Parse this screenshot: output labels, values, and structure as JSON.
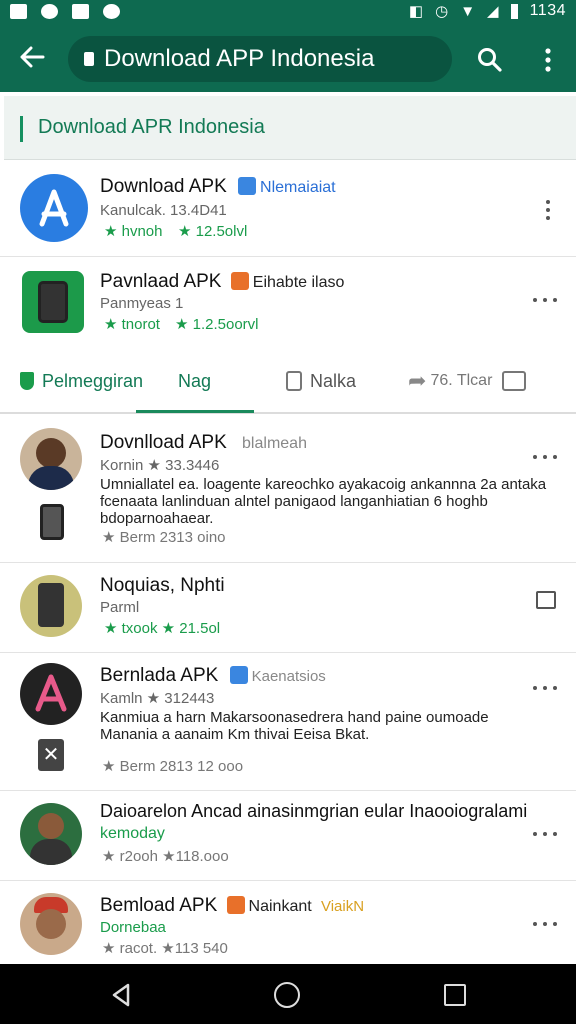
{
  "status_bar": {
    "time": "1134"
  },
  "app_bar": {
    "title": "Download APP Indonesia"
  },
  "section": {
    "title": "Download APR Indonesia"
  },
  "top_apps": [
    {
      "title": "Download APK",
      "tag": "Nlemaiaiat",
      "sub": "Kanulcak. 13.4D41",
      "stat1": "★ hvnoh",
      "stat2": "★ 12.5olvl"
    },
    {
      "title": "Pavnlaad APK",
      "tag": "Eihabte ilaso",
      "sub": "Panmyeas 1",
      "stat1": "★ tnorot",
      "stat2": "★ 1.2.5oorvl"
    }
  ],
  "tabs": [
    {
      "label": "Pelmeggiran"
    },
    {
      "label": "Nag"
    },
    {
      "label": "Nalka"
    },
    {
      "label": "76. Tlcar"
    }
  ],
  "feed": [
    {
      "title": "Dovnlload APK",
      "tag": "blalmeah",
      "sub": "Kornin ★ 33.3446",
      "desc": "Umniallatel ea. loagente kareochko ayakacoig ankannna 2a antaka fcenaata lanlinduan alntel panigaod langanhiatian 6 hoghb bdoparnoahaear.",
      "meta": "★ Berm   2313 oino"
    },
    {
      "title": "Noquias, Nphti",
      "tag": "",
      "sub": "Parml",
      "desc": "",
      "meta": "★ txook   ★ 21.5ol"
    },
    {
      "title": "Bernlada APK",
      "tag": "Kaenatsios",
      "sub": "Kamln ★ 312443",
      "desc": "Kanmiua a harn Makarsoonasedrera hand paine oumoade Manania a aanaim Km thivai Eeisa Bkat.",
      "meta": "★ Berm   2813 12 ooo"
    },
    {
      "title": "Daioarelon Ancad ainasinmgrian eular Inaooiogralami",
      "tag": "",
      "sub": "kemoday",
      "desc": "",
      "meta": "★ r2ooh   ★118.ooo"
    },
    {
      "title": "Bemload APK",
      "tag": "Nainkant",
      "tag2": "ViaikN",
      "sub": "Dornebaa",
      "desc": "",
      "meta": "★ racot.   ★113 540"
    }
  ],
  "colors": {
    "brand": "#0e6a50",
    "accent_green": "#1a9c4b",
    "blue": "#3a86e0"
  }
}
